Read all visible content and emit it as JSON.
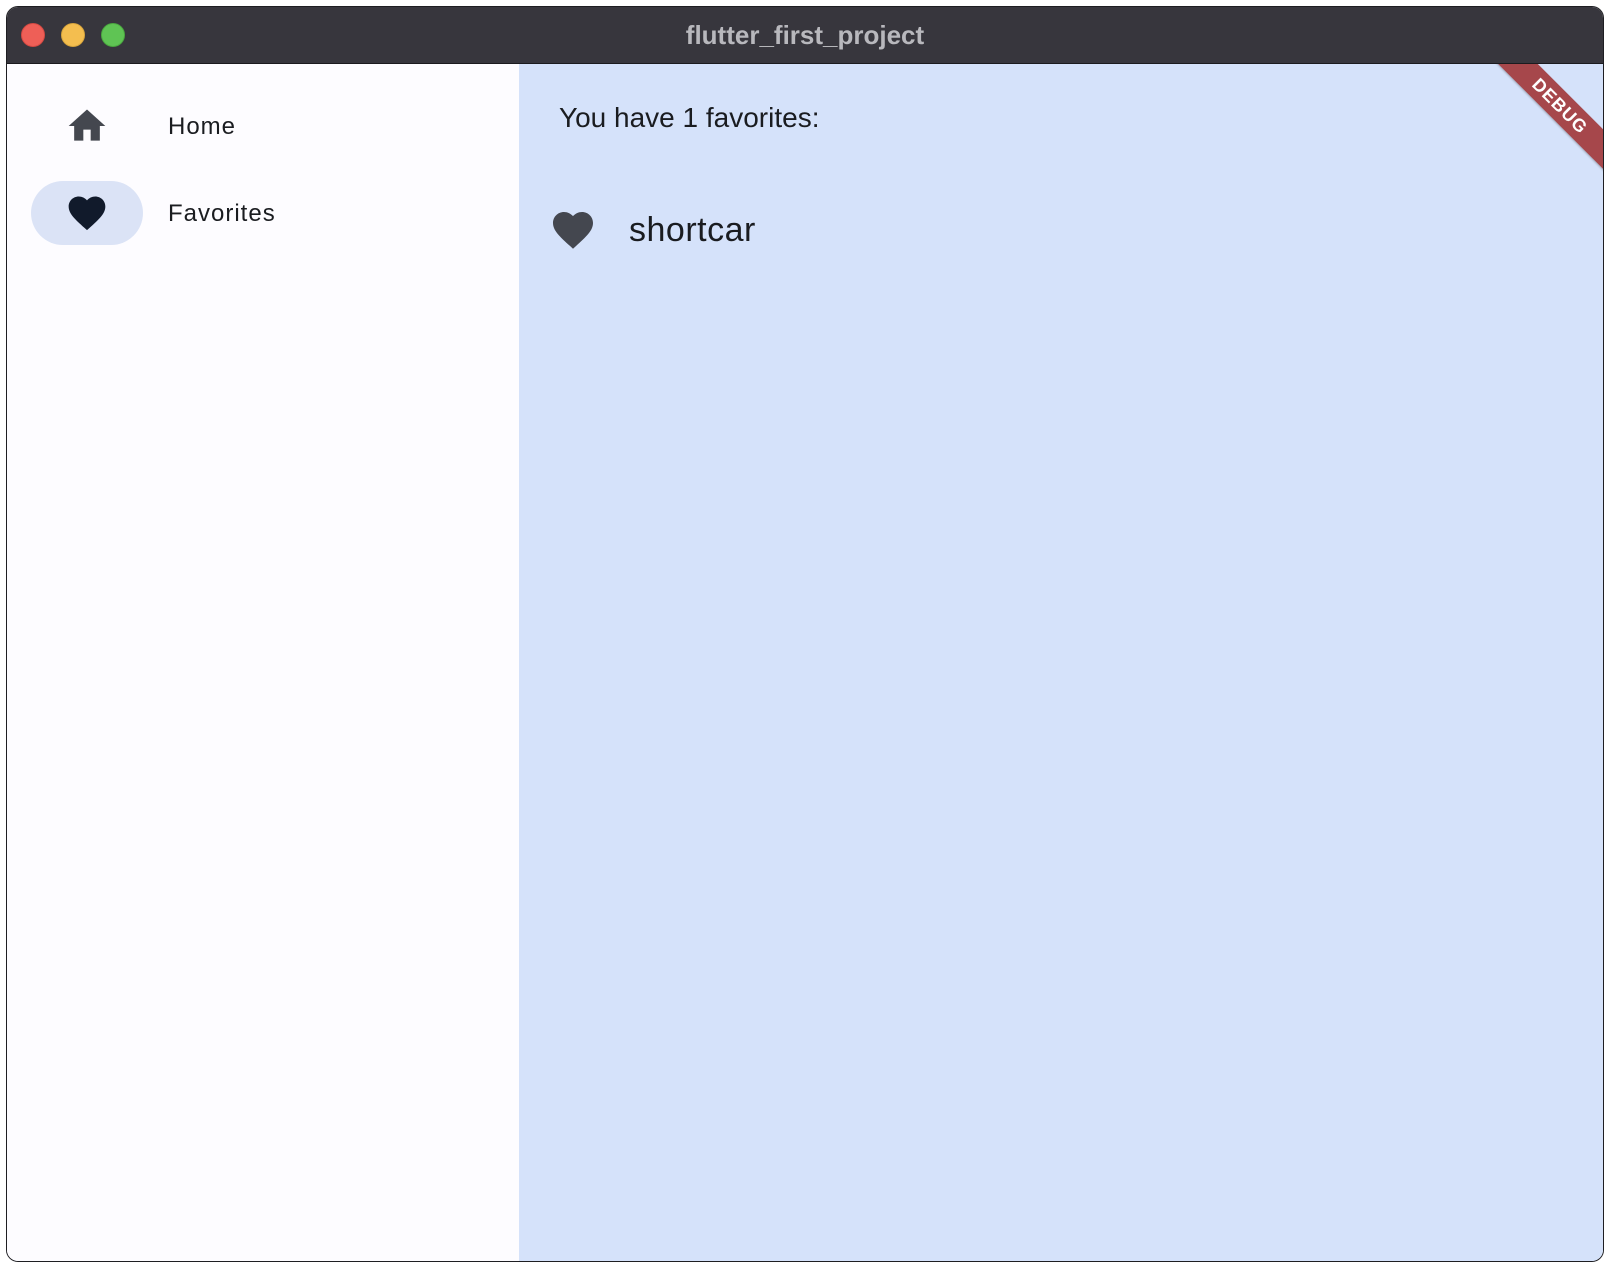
{
  "window": {
    "title": "flutter_first_project"
  },
  "nav": {
    "items": [
      {
        "label": "Home",
        "icon": "home-icon",
        "selected": false
      },
      {
        "label": "Favorites",
        "icon": "heart-icon",
        "selected": true
      }
    ]
  },
  "main": {
    "heading": "You have 1 favorites:",
    "favorites": [
      {
        "text": "shortcar",
        "icon": "heart-icon"
      }
    ]
  },
  "debug_banner": "DEBUG",
  "colors": {
    "titlebar": "#37363d",
    "rail_background": "#fdfcff",
    "content_background": "#d5e2fa",
    "selected_indicator": "#dbe3f6",
    "debug_ribbon": "#a6474b"
  }
}
